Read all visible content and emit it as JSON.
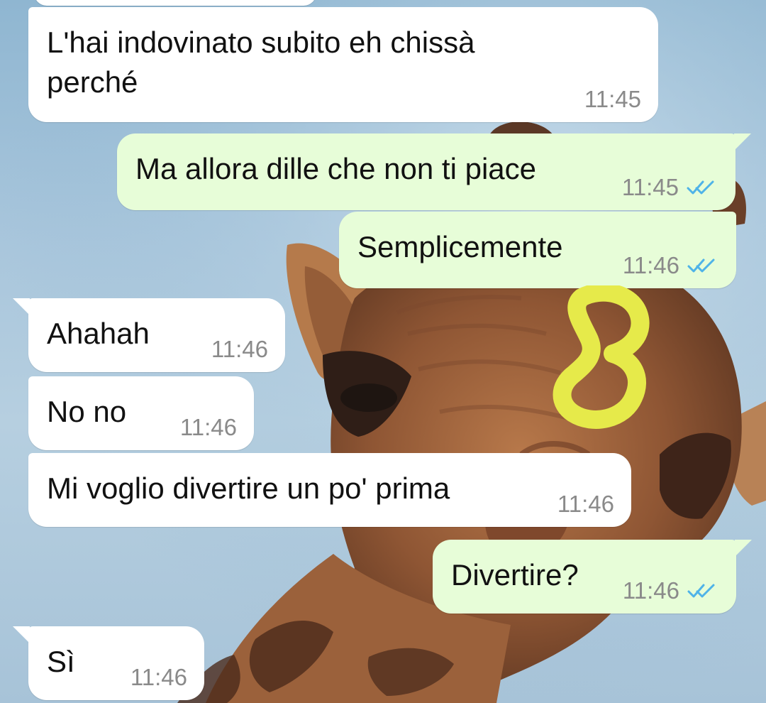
{
  "chat": {
    "messages": [
      {
        "id": "m1",
        "direction": "incoming",
        "text": "L'hai indovinato subito eh chissà\nperché",
        "time": "11:45"
      },
      {
        "id": "m2",
        "direction": "outgoing",
        "text": "Ma allora dille che non ti piace",
        "time": "11:45",
        "status": "read"
      },
      {
        "id": "m3",
        "direction": "outgoing",
        "text": "Semplicemente",
        "time": "11:46",
        "status": "read"
      },
      {
        "id": "m4",
        "direction": "incoming",
        "text": "Ahahah",
        "time": "11:46"
      },
      {
        "id": "m5",
        "direction": "incoming",
        "text": "No no",
        "time": "11:46"
      },
      {
        "id": "m6",
        "direction": "incoming",
        "text": "Mi voglio divertire un po' prima",
        "time": "11:46"
      },
      {
        "id": "m7",
        "direction": "outgoing",
        "text": "Divertire?",
        "time": "11:46",
        "status": "read"
      },
      {
        "id": "m8",
        "direction": "incoming",
        "text": "Sì",
        "time": "11:46"
      }
    ]
  },
  "colors": {
    "incoming_bubble": "#ffffff",
    "outgoing_bubble": "#e7fdd8",
    "read_check": "#4fb3e8",
    "timestamp": "#8a8a8a",
    "doodle": "#e6ea4a"
  },
  "icons": {
    "read_receipt": "double-check-icon"
  }
}
